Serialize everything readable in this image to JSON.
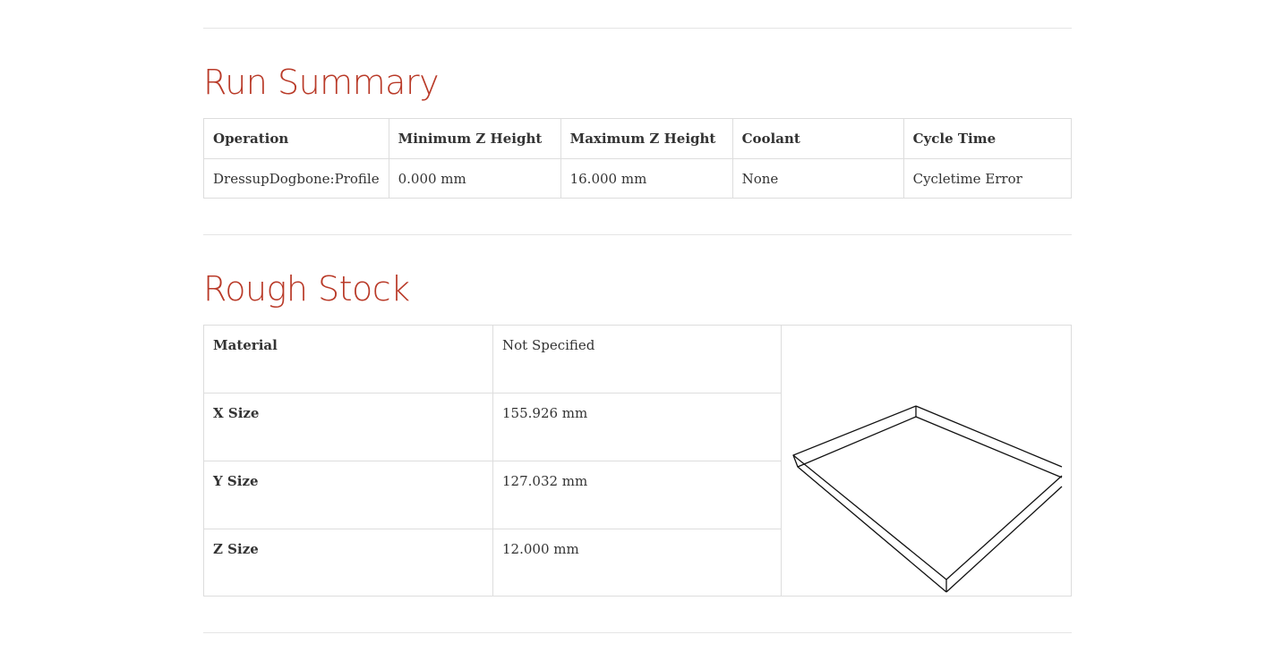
{
  "run_summary": {
    "title": "Run Summary",
    "headers": [
      "Operation",
      "Minimum Z Height",
      "Maximum Z Height",
      "Coolant",
      "Cycle Time"
    ],
    "row": [
      "DressupDogbone:Profile",
      "0.000 mm",
      "16.000 mm",
      "None",
      "Cycletime Error"
    ]
  },
  "rough_stock": {
    "title": "Rough Stock",
    "rows": [
      {
        "label": "Material",
        "value": "Not Specified"
      },
      {
        "label": "X Size",
        "value": "155.926 mm"
      },
      {
        "label": "Y Size",
        "value": "127.032 mm"
      },
      {
        "label": "Z Size",
        "value": "12.000 mm"
      }
    ],
    "image": "stock-wireframe-box"
  },
  "colors": {
    "heading": "#b93a28",
    "text": "#333333",
    "border": "#dddddd",
    "rule": "#e5e5e5"
  }
}
